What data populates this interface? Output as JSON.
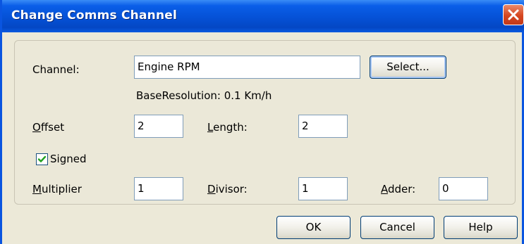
{
  "window": {
    "title": "Change Comms Channel"
  },
  "form": {
    "channel_label": "Channel:",
    "channel_value": "Engine RPM",
    "select_button": "Select...",
    "base_resolution": "BaseResolution: 0.1 Km/h",
    "offset": {
      "label_underline": "O",
      "label_rest": "ffset",
      "value": "2"
    },
    "length": {
      "label_underline": "L",
      "label_rest": "ength:",
      "value": "2"
    },
    "signed": {
      "label": "Signed",
      "checked": true
    },
    "multiplier": {
      "label_underline": "M",
      "label_rest": "ultiplier",
      "value": "1"
    },
    "divisor": {
      "label_underline": "D",
      "label_rest": "ivisor:",
      "value": "1"
    },
    "adder": {
      "label_underline": "A",
      "label_rest": "dder:",
      "value": "0"
    }
  },
  "buttons": {
    "ok": "OK",
    "cancel": "Cancel",
    "help": "Help"
  },
  "colors": {
    "titlebar": "#0551d6",
    "dialog_bg": "#ece9d8",
    "close": "#d6461f",
    "checkmark": "#21a121"
  },
  "icons": {
    "close": "close-icon",
    "check": "checkmark-icon"
  }
}
